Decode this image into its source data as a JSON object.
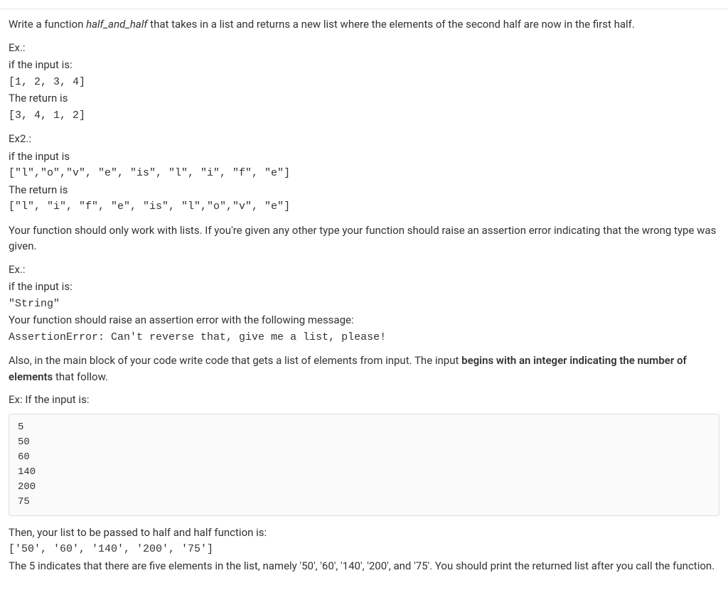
{
  "intro": {
    "prefix": "Write a function ",
    "funcname": "half_and_half",
    "suffix": " that takes in a list and returns a new list where the elements of the second half are now in the first half."
  },
  "ex1": {
    "label": "Ex.:",
    "line1": "if the input is:",
    "code1": "[1, 2, 3, 4]",
    "line2": "The return is",
    "code2": "[3, 4, 1, 2]"
  },
  "ex2": {
    "label": "Ex2.:",
    "line1": "if the input is",
    "code1": "[\"l\",\"o\",\"v\", \"e\", \"is\", \"l\", \"i\", \"f\", \"e\"]",
    "line2": "The return is",
    "code2": "[\"l\", \"i\", \"f\", \"e\", \"is\", \"l\",\"o\",\"v\", \"e\"]"
  },
  "typecheck": "Your function should only work with lists. If you're given any other type your function should raise an assertion error indicating that the wrong type was given.",
  "ex3": {
    "label": "Ex.:",
    "line1": "if the input is:",
    "code1": "\"String\"",
    "line2": "Your function should raise an assertion error with the following message:",
    "code2": "AssertionError: Can't reverse that, give me a list, please!"
  },
  "mainblock": {
    "prefix": "Also, in the main block of your code write code that gets a list of elements from input. The input ",
    "bold": "begins with an integer indicating the number of elements",
    "suffix": " that follow."
  },
  "ex_input_label": "Ex: If the input is:",
  "input_sample": [
    "5",
    "50",
    "60",
    "140",
    "200",
    "75"
  ],
  "then": {
    "line1": "Then, your list to be passed to half and half function is:",
    "code": "['50', '60', '140', '200', '75']",
    "line2": "The 5 indicates that there are five elements in the list, namely '50', '60', '140', '200', and '75'. You should print the returned list after you call the function."
  }
}
